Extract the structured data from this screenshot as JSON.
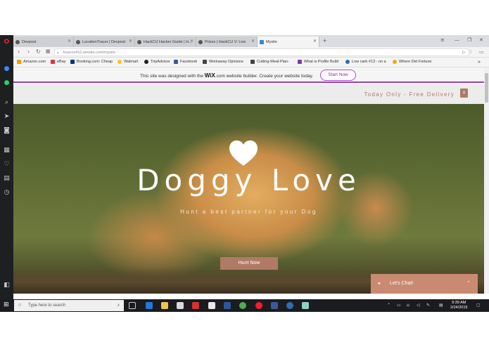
{
  "browser": {
    "tabs": [
      {
        "label": "Devpost"
      },
      {
        "label": "LocationTracer | Devpost"
      },
      {
        "label": "HackCU Hacker Guide | H..."
      },
      {
        "label": "Prizes | HackCU V: Live"
      },
      {
        "label": "Mysite"
      }
    ],
    "url": "bsacco412.wixsite.com/mysite",
    "bookmarks": [
      {
        "label": "Amazon.com"
      },
      {
        "label": "eBay"
      },
      {
        "label": "Booking.com: Cheap"
      },
      {
        "label": "Walmart"
      },
      {
        "label": "TripAdvisor"
      },
      {
        "label": "Facebook"
      },
      {
        "label": "Workaway Opinions"
      },
      {
        "label": "Cutting-Meal-Plan-"
      },
      {
        "label": "What is Profile Build"
      },
      {
        "label": "Low carb #13 - on a"
      },
      {
        "label": "Where Did Fortune"
      }
    ]
  },
  "wix_banner": {
    "text_before": "This site was designed with the",
    "brand": "WiX",
    "text_after": ".com website builder. Create your website today.",
    "button": "Start Now",
    "accent": "#a23bb5"
  },
  "site": {
    "promo": "Today Only - Free Delivery",
    "bag_count": "0",
    "hero_title": "Doggy Love",
    "hero_subtitle": "Hunt a best partner for your Dog",
    "hero_button": "Hunt Now",
    "chat_label": "Let's Chat!",
    "accent": "#b07a66"
  },
  "taskbar": {
    "search_placeholder": "Type here to search",
    "time": "9:39 AM",
    "date": "2/24/2019"
  }
}
